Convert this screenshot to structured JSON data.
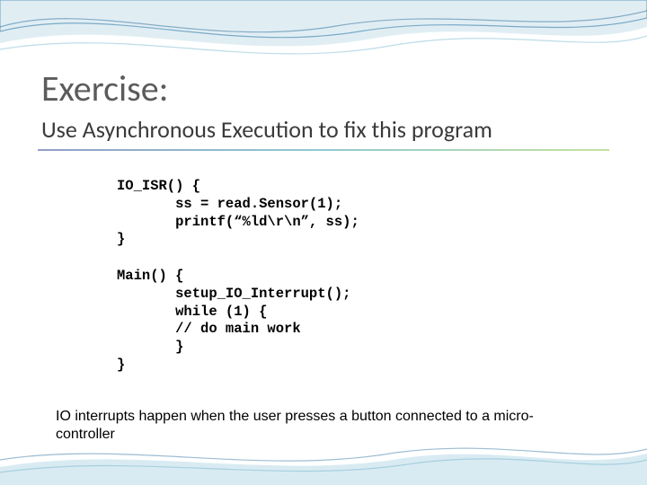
{
  "title": "Exercise:",
  "subtitle": "Use Asynchronous Execution to fix this program",
  "code": {
    "isr": "IO_ISR() {\n       ss = read.Sensor(1);\n       printf(“%ld\\r\\n”, ss);\n}",
    "main": "Main() {\n       setup_IO_Interrupt();\n       while (1) {\n       // do main work\n       }\n}"
  },
  "footnote": "IO interrupts happen when the user presses a button connected to a micro-controller"
}
